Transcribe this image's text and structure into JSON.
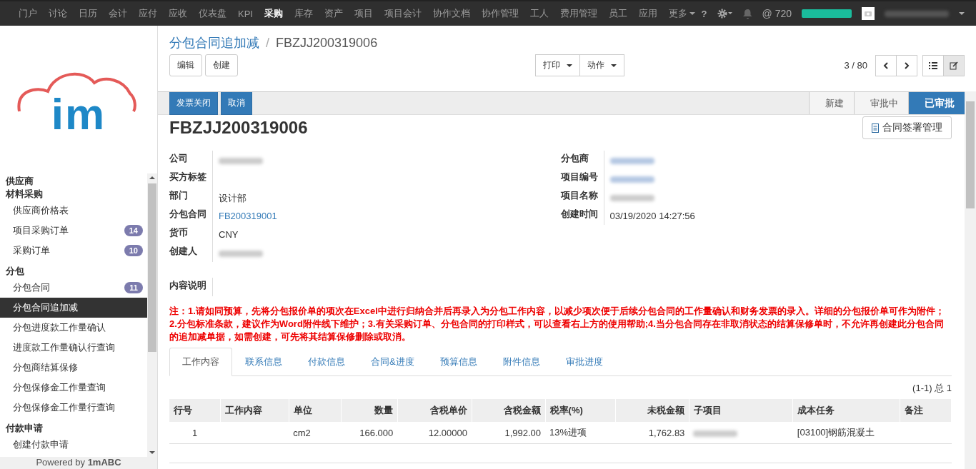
{
  "top_nav": {
    "items": [
      {
        "label": "门户",
        "selected": false
      },
      {
        "label": "讨论",
        "selected": false
      },
      {
        "label": "日历",
        "selected": false
      },
      {
        "label": "会计",
        "selected": false
      },
      {
        "label": "应付",
        "selected": false
      },
      {
        "label": "应收",
        "selected": false
      },
      {
        "label": "仪表盘",
        "selected": false
      },
      {
        "label": "KPI",
        "selected": false
      },
      {
        "label": "采购",
        "selected": true
      },
      {
        "label": "库存",
        "selected": false
      },
      {
        "label": "资产",
        "selected": false
      },
      {
        "label": "项目",
        "selected": false
      },
      {
        "label": "项目会计",
        "selected": false
      },
      {
        "label": "协作文档",
        "selected": false
      },
      {
        "label": "协作管理",
        "selected": false
      },
      {
        "label": "工人",
        "selected": false
      },
      {
        "label": "费用管理",
        "selected": false
      },
      {
        "label": "员工",
        "selected": false
      },
      {
        "label": "应用",
        "selected": false
      }
    ],
    "more": "更多",
    "help": "?",
    "mentions": "@ 720",
    "progress": {
      "level": 1
    }
  },
  "sidebar": {
    "logo_text": "im",
    "sections": [
      {
        "title": "供应商"
      },
      {
        "title": "材料采购",
        "items": [
          {
            "label": "供应商价格表",
            "selected": false
          },
          {
            "label": "项目采购订单",
            "badge": "14",
            "selected": false
          },
          {
            "label": "采购订单",
            "badge": "10",
            "selected": false
          }
        ]
      },
      {
        "title": "分包",
        "items": [
          {
            "label": "分包合同",
            "badge": "11",
            "selected": false
          },
          {
            "label": "分包合同追加减",
            "selected": true
          },
          {
            "label": "分包进度款工作量确认",
            "selected": false
          },
          {
            "label": "进度款工作量确认行查询",
            "selected": false
          },
          {
            "label": "分包商结算保修",
            "selected": false
          },
          {
            "label": "分包保修金工作量查询",
            "selected": false
          },
          {
            "label": "分包保修金工作量行查询",
            "selected": false
          }
        ]
      },
      {
        "title": "付款申请",
        "items": [
          {
            "label": "创建付款申请",
            "selected": false
          }
        ]
      }
    ],
    "footer": "Powered by **1mABC**"
  },
  "breadcrumb": {
    "parent": "分包合同追加减",
    "separator": "/",
    "current": "FBZJJ200319006"
  },
  "buttons": {
    "left": [
      "编辑",
      "创建"
    ],
    "center": [
      "打印",
      "动作"
    ]
  },
  "pager": {
    "text": "3 / 80"
  },
  "header_buttons": [
    "发票关闭",
    "取消"
  ],
  "status_steps": [
    {
      "label": "新建",
      "selected": false
    },
    {
      "label": "审批中",
      "selected": false
    },
    {
      "label": "已审批",
      "selected": true
    }
  ],
  "record": {
    "title": "FBZJJ200319006",
    "sign_button": "合同签署管理",
    "left_fields": [
      {
        "label": "公司",
        "kind": "blurred"
      },
      {
        "label": "买方标签",
        "kind": "empty"
      },
      {
        "label": "部门",
        "kind": "text",
        "value": "设计部"
      },
      {
        "label": "分包合同",
        "kind": "link",
        "value": "FB200319001"
      },
      {
        "label": "货币",
        "kind": "text",
        "value": "CNY"
      },
      {
        "label": "创建人",
        "kind": "blurred"
      }
    ],
    "right_fields": [
      {
        "label": "分包商",
        "kind": "blurred_link"
      },
      {
        "label": "项目编号",
        "kind": "blurred_link"
      },
      {
        "label": "项目名称",
        "kind": "blurred"
      },
      {
        "label": "创建时间",
        "kind": "text",
        "value": "03/19/2020 14:27:56"
      }
    ],
    "description_label": "内容说明",
    "note": "注：1.请如同预算，先将分包报价单的项次在Excel中进行归纳合并后再录入为分包工作内容，以减少项次便于后续分包合同的工作量确认和财务发票的录入。详细的分包报价单可作为附件；2.分包标准条款，建议作为Word附件线下维护；3.有关采购订单、分包合同的打印样式，可以查看右上方的使用帮助;4.当分包合同存在非取消状态的结算保修单时，不允许再创建此分包合同的追加减单据，如需创建，可先将其结算保修删除或取消。"
  },
  "tabs": [
    {
      "label": "工作内容",
      "selected": true
    },
    {
      "label": "联系信息",
      "selected": false
    },
    {
      "label": "付款信息",
      "selected": false
    },
    {
      "label": "合同&进度",
      "selected": false
    },
    {
      "label": "预算信息",
      "selected": false
    },
    {
      "label": "附件信息",
      "selected": false
    },
    {
      "label": "审批进度",
      "selected": false
    }
  ],
  "table": {
    "pager": "(1-1) 总 1",
    "columns": [
      "行号",
      "工作内容",
      "单位",
      "数量",
      "含税单价",
      "含税金额",
      "税率(%)",
      "未税金额",
      "子项目",
      "成本任务",
      "备注"
    ],
    "rows": [
      {
        "cells": [
          {
            "kind": "text",
            "value": "1"
          },
          {
            "kind": "empty"
          },
          {
            "kind": "text",
            "value": "cm2"
          },
          {
            "kind": "text",
            "value": "166.000"
          },
          {
            "kind": "text",
            "value": "12.00000"
          },
          {
            "kind": "text",
            "value": "1,992.00"
          },
          {
            "kind": "text",
            "value": "13%进项"
          },
          {
            "kind": "text",
            "value": "1,762.83"
          },
          {
            "kind": "blurred"
          },
          {
            "kind": "text",
            "value": "[03100]钢筋混凝土"
          },
          {
            "kind": "empty"
          }
        ]
      }
    ]
  }
}
